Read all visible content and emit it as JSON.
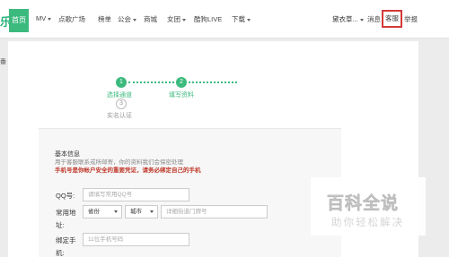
{
  "nav": {
    "logo_fragment": "乐",
    "home": "首页",
    "items": [
      {
        "label": "MV",
        "caret": true
      },
      {
        "label": "点歌广场",
        "caret": false
      },
      {
        "label": "榜单",
        "caret": false
      },
      {
        "label": "公会",
        "caret": true
      },
      {
        "label": "商城",
        "caret": false
      },
      {
        "label": "女团",
        "caret": true
      },
      {
        "label": "酷狗LIVE",
        "caret": false
      },
      {
        "label": "下载",
        "caret": true
      }
    ],
    "user_name": "黛衣草...",
    "messages": "消息",
    "service": "客服",
    "report": "举报"
  },
  "left_fragment": "番",
  "steps": [
    {
      "num": "1",
      "label": "选择通道",
      "active": true
    },
    {
      "num": "2",
      "label": "填写资料",
      "active": true
    },
    {
      "num": "3",
      "label": "实名认证",
      "active": false
    }
  ],
  "form": {
    "section_title": "基本信息",
    "section_note": "用于客服联系或所邮寄，你的资料我们会保密处理",
    "warning": "手机号是你帐户安全的重要凭证，请务必绑定自己的手机",
    "qq_label": "QQ号:",
    "qq_placeholder": "请填写常用QQ号",
    "address_label_1": "常用地",
    "address_label_2": "址:",
    "province": "省份",
    "city": "城市",
    "street_placeholder": "详细街道门牌号",
    "phone_label_1": "绑定手",
    "phone_label_2": "机:",
    "phone_placeholder": "11位手机号码"
  },
  "watermark": {
    "main": "百科全说",
    "sub": "助你轻松解决"
  },
  "colors": {
    "accent_green": "#3cba7e",
    "warning_red": "#c0392b",
    "highlight_box": "#d23a3a"
  }
}
